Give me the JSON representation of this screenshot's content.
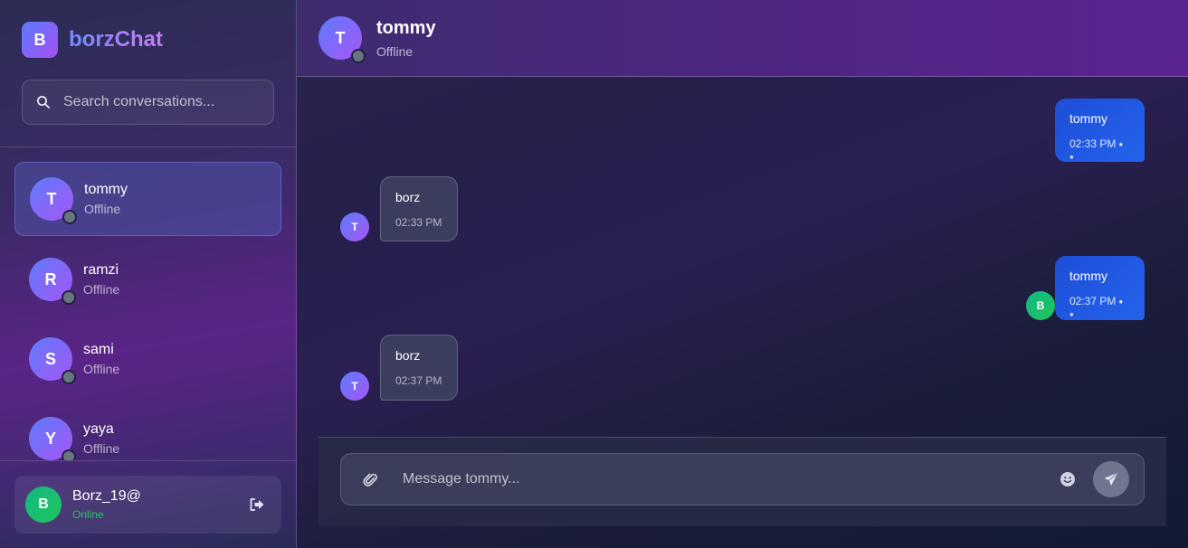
{
  "brand": {
    "logo_letter": "B",
    "name": "borzChat"
  },
  "search": {
    "placeholder": "Search conversations...",
    "value": ""
  },
  "conversations": [
    {
      "initial": "T",
      "name": "tommy",
      "status": "Offline",
      "active": true
    },
    {
      "initial": "R",
      "name": "ramzi",
      "status": "Offline",
      "active": false
    },
    {
      "initial": "S",
      "name": "sami",
      "status": "Offline",
      "active": false
    },
    {
      "initial": "Y",
      "name": "yaya",
      "status": "Offline",
      "active": false
    }
  ],
  "current_user": {
    "initial": "B",
    "name": "Borz_19@",
    "status": "Online"
  },
  "chat_header": {
    "initial": "T",
    "name": "tommy",
    "status": "Offline"
  },
  "messages": [
    {
      "direction": "sent",
      "text": "tommy",
      "time": "02:33 PM",
      "avatar": ""
    },
    {
      "direction": "received",
      "text": "borz",
      "time": "02:33 PM",
      "avatar": "T"
    },
    {
      "direction": "sent",
      "text": "tommy",
      "time": "02:37 PM",
      "avatar": "B"
    },
    {
      "direction": "received",
      "text": "borz",
      "time": "02:37 PM",
      "avatar": "T"
    }
  ],
  "composer": {
    "placeholder": "Message tommy...",
    "value": ""
  },
  "icons": {
    "search": "search-icon",
    "logout": "logout-icon",
    "attach": "paperclip-icon",
    "emoji": "smiley-icon",
    "send": "send-icon"
  },
  "colors": {
    "accent_blue": "#2563eb",
    "online_green": "#22c55e",
    "offline_gray": "#6b7280"
  }
}
